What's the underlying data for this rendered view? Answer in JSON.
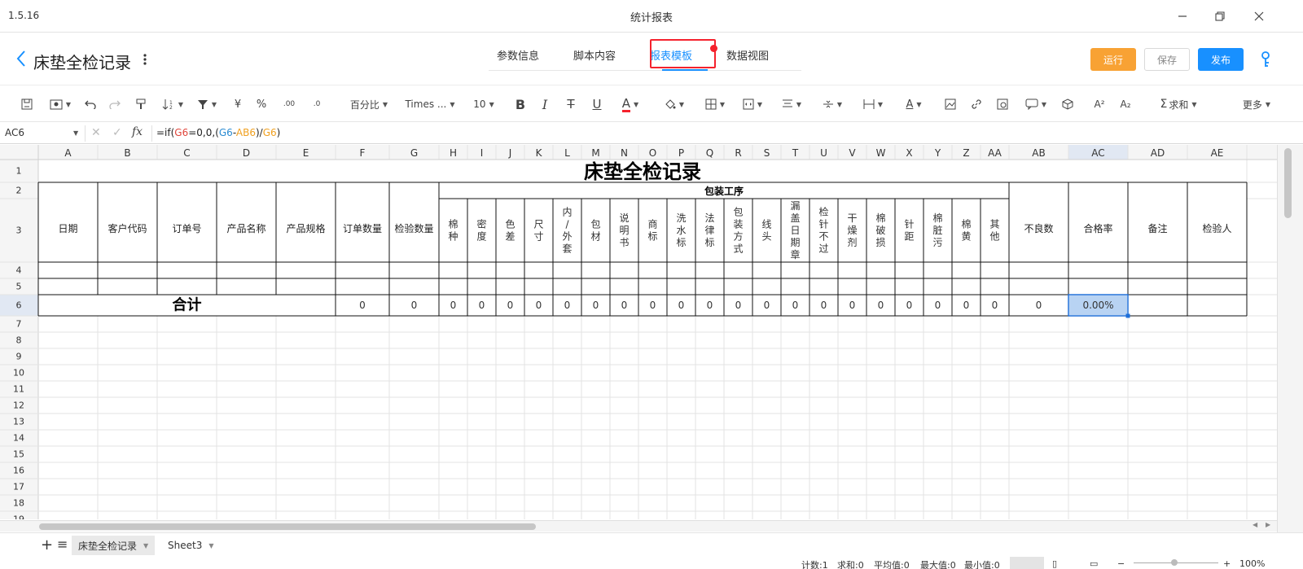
{
  "window": {
    "version": "1.5.16",
    "title": "统计报表"
  },
  "header": {
    "title": "床垫全检记录",
    "tabs": [
      {
        "label": "参数信息",
        "active": false
      },
      {
        "label": "脚本内容",
        "active": false
      },
      {
        "label": "报表模板",
        "active": true
      },
      {
        "label": "数据视图",
        "active": false
      }
    ],
    "buttons": {
      "run": "运行",
      "save": "保存",
      "publish": "发布"
    },
    "colors": {
      "accent": "#1890ff",
      "run": "#f8a234",
      "highlight": "#f5222d"
    }
  },
  "toolbar": {
    "number_format": "百分比",
    "font": "Times ...",
    "font_size": "10",
    "sum": "求和",
    "more": "更多",
    "currency": "¥",
    "percent": "%",
    "dec_inc": ".00→.0",
    "dec_dec": ".0→.00"
  },
  "formula_bar": {
    "cell_ref": "AC6",
    "formula_parts": [
      {
        "t": "=if(",
        "c": "#222"
      },
      {
        "t": "G6",
        "c": "#e0463c"
      },
      {
        "t": "=0,0,(",
        "c": "#222"
      },
      {
        "t": "G6",
        "c": "#2a8bd2"
      },
      {
        "t": "-",
        "c": "#222"
      },
      {
        "t": "AB6",
        "c": "#f0a020"
      },
      {
        "t": ")/",
        "c": "#222"
      },
      {
        "t": "G6",
        "c": "#f0a020"
      },
      {
        "t": ")",
        "c": "#222"
      }
    ]
  },
  "sheet": {
    "columns": [
      "A",
      "B",
      "C",
      "D",
      "E",
      "F",
      "G",
      "H",
      "I",
      "J",
      "K",
      "L",
      "M",
      "N",
      "O",
      "P",
      "Q",
      "R",
      "S",
      "T",
      "U",
      "V",
      "W",
      "X",
      "Y",
      "Z",
      "AA",
      "AB",
      "AC",
      "AD",
      "AE"
    ],
    "rows": [
      "1",
      "2",
      "3",
      "4",
      "5",
      "6",
      "7",
      "8",
      "9",
      "10",
      "11",
      "12",
      "13",
      "14",
      "15",
      "16",
      "17",
      "18",
      "19"
    ],
    "selected_cell": "AC6",
    "report_title": "床垫全检记录",
    "group_header": "包装工序",
    "headers_main": [
      "日期",
      "客户代码",
      "订单号",
      "产品名称",
      "产品规格",
      "订单数量",
      "检验数量"
    ],
    "headers_packaging": [
      "棉种",
      "密度",
      "色差",
      "尺寸",
      "内/外套",
      "包材",
      "说明书",
      "商标",
      "洗水标",
      "法律标",
      "包装方式",
      "线头",
      "漏盖日期章",
      "检针不过",
      "干燥剂",
      "棉破损",
      "针距",
      "棉脏污",
      "棉黄",
      "其他"
    ],
    "headers_tail": [
      "不良数",
      "合格率",
      "备注",
      "检验人"
    ],
    "total_label": "合计",
    "total_values": [
      "0",
      "0",
      "0",
      "0",
      "0",
      "0",
      "0",
      "0",
      "0",
      "0",
      "0",
      "0",
      "0",
      "0",
      "0",
      "0",
      "0",
      "0",
      "0",
      "0",
      "0",
      "0",
      "0"
    ],
    "pass_rate": "0.00%"
  },
  "sheets": {
    "tabs": [
      {
        "label": "床垫全检记录",
        "active": true
      },
      {
        "label": "Sheet3",
        "active": false
      }
    ]
  },
  "status": {
    "count": "计数:1",
    "sum": "求和:0",
    "avg": "平均值:0",
    "max": "最大值:0",
    "min": "最小值:0",
    "zoom": "100%"
  }
}
